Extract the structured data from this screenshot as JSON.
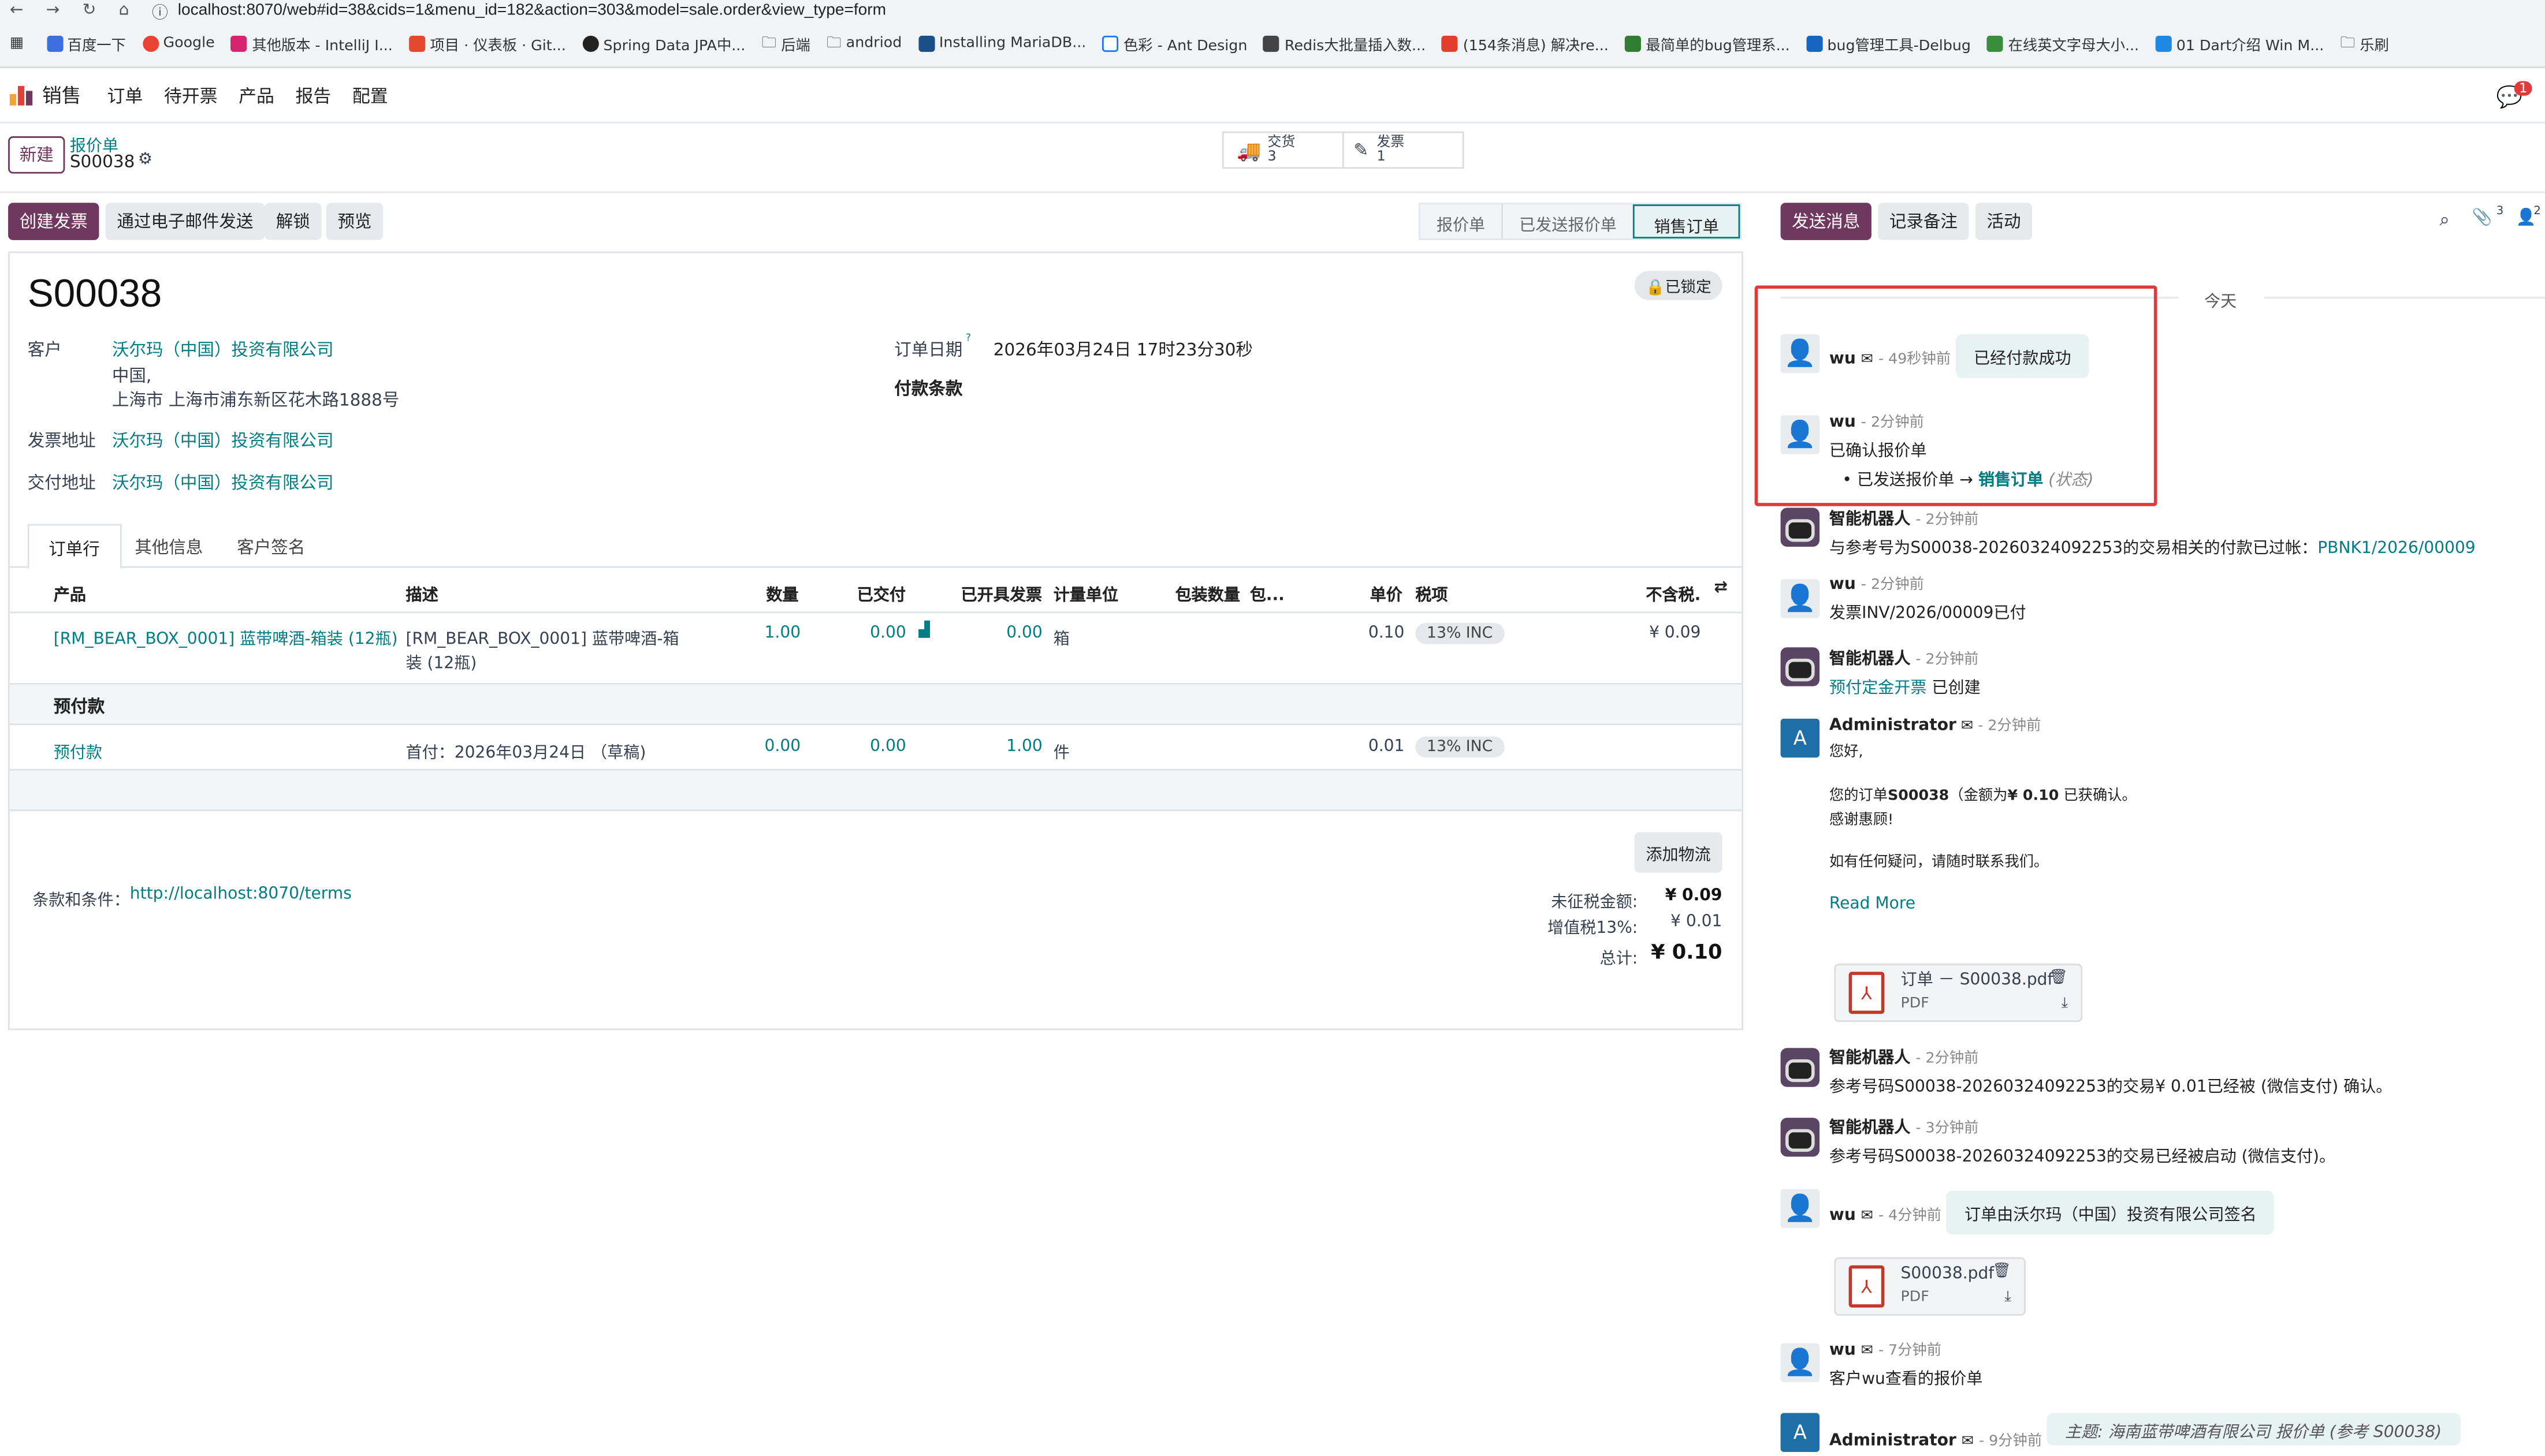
{
  "browser": {
    "url": "localhost:8070/web#id=38&cids=1&menu_id=182&action=303&model=sale.order&view_type=form",
    "bookmarks": [
      "百度一下",
      "Google",
      "其他版本 - IntelliJ I...",
      "项目 · 仪表板 · Git...",
      "Spring Data JPA中...",
      "后端",
      "andriod",
      "Installing MariaDB...",
      "色彩 - Ant Design",
      "Redis大批量插入数...",
      "(154条消息) 解决re...",
      "最简单的bug管理系...",
      "bug管理工具-Delbug",
      "在线英文字母大小...",
      "01 Dart介绍 Win M...",
      "乐刷"
    ]
  },
  "nav": {
    "app": "销售",
    "items": [
      "订单",
      "待开票",
      "产品",
      "报告",
      "配置"
    ],
    "chat_badge": "1"
  },
  "cp": {
    "new": "新建",
    "breadcrumb": "报价单",
    "record": "S00038",
    "delivery_label": "交货",
    "delivery_count": "3",
    "invoice_label": "发票",
    "invoice_count": "1"
  },
  "actions": {
    "create_invoice": "创建发票",
    "send_email": "通过电子邮件发送",
    "unlock": "解锁",
    "preview": "预览"
  },
  "status": [
    "报价单",
    "已发送报价单",
    "销售订单"
  ],
  "form": {
    "title": "S00038",
    "locked": "已锁定",
    "customer_label": "客户",
    "customer": "沃尔玛（中国）投资有限公司",
    "addr1": "中国,",
    "addr2": "上海市 上海市浦东新区花木路1888号",
    "invoice_addr_label": "发票地址",
    "invoice_addr": "沃尔玛（中国）投资有限公司",
    "delivery_addr_label": "交付地址",
    "delivery_addr": "沃尔玛（中国）投资有限公司",
    "order_date_label": "订单日期",
    "order_date_sup": "?",
    "order_date": "2026年03月24日 17时23分30秒",
    "payment_terms_label": "付款条款",
    "tabs": [
      "订单行",
      "其他信息",
      "客户签名"
    ],
    "columns": [
      "产品",
      "描述",
      "数量",
      "已交付",
      "已开具发票",
      "计量单位",
      "包装数量",
      "包...",
      "单价",
      "税项",
      "不含税."
    ],
    "line1": {
      "product": "[RM_BEAR_BOX_0001] 蓝带啤酒-箱装 (12瓶)",
      "desc1": "[RM_BEAR_BOX_0001] 蓝带啤酒-箱",
      "desc2": "装 (12瓶)",
      "qty": "1.00",
      "delivered": "0.00",
      "invoiced": "0.00",
      "uom": "箱",
      "price": "0.10",
      "tax": "13% INC",
      "subtotal": "¥ 0.09"
    },
    "section": "预付款",
    "line2": {
      "product": "预付款",
      "desc": "首付：2026年03月24日 （草稿)",
      "qty": "0.00",
      "delivered": "0.00",
      "invoiced": "1.00",
      "uom": "件",
      "price": "0.01",
      "tax": "13% INC"
    },
    "add_shipping": "添加物流",
    "terms_label": "条款和条件：",
    "terms_link": "http://localhost:8070/terms",
    "untaxed_label": "未征税金额:",
    "untaxed": "¥ 0.09",
    "vat_label": "增值税13%:",
    "vat": "¥ 0.01",
    "total_label": "总计:",
    "total": "¥ 0.10"
  },
  "chatter": {
    "send": "发送消息",
    "note": "记录备注",
    "activity": "活动",
    "attach_count": "3",
    "follow_count": "2",
    "today": "今天",
    "m1": {
      "name": "wu",
      "time": "- 49秒钟前",
      "body": "已经付款成功"
    },
    "m2": {
      "name": "wu",
      "time": "- 2分钟前",
      "body": "已确认报价单",
      "old": "已发送报价单",
      "arrow": "→",
      "new": "销售订单",
      "field": "(状态)"
    },
    "m3": {
      "name": "智能机器人",
      "time": "- 2分钟前",
      "body": "与参考号为S00038-20260324092253的交易相关的付款已过帐：",
      "link": "PBNK1/2026/00009"
    },
    "m4": {
      "name": "wu",
      "time": "- 2分钟前",
      "body": "发票INV/2026/00009已付"
    },
    "m5": {
      "name": "智能机器人",
      "time": "- 2分钟前",
      "link": "预付定金开票",
      "body": "已创建"
    },
    "m6": {
      "name": "Administrator",
      "time": "- 2分钟前",
      "l1": "您好,",
      "l2a": "您的订单",
      "l2b": "S00038",
      "l2c": "（金额为",
      "l2d": "¥ 0.10",
      "l2e": "已获确认。",
      "l3": "感谢惠顾!",
      "l4": "如有任何疑问，请随时联系我们。",
      "more": "Read More",
      "file": "订单 － S00038.pdf",
      "ftype": "PDF"
    },
    "m7": {
      "name": "智能机器人",
      "time": "- 2分钟前",
      "body": "参考号码S00038-20260324092253的交易¥ 0.01已经被 (微信支付) 确认。"
    },
    "m8": {
      "name": "智能机器人",
      "time": "- 3分钟前",
      "body": "参考号码S00038-20260324092253的交易已经被启动 (微信支付)。"
    },
    "m9": {
      "name": "wu",
      "time": "- 4分钟前",
      "body": "订单由沃尔玛（中国）投资有限公司签名",
      "file": "S00038.pdf",
      "ftype": "PDF"
    },
    "m10": {
      "name": "wu",
      "time": "- 7分钟前",
      "body": "客户wu查看的报价单"
    },
    "m11": {
      "name": "Administrator",
      "time": "- 9分钟前",
      "body": "主题: 海南蓝带啤酒有限公司 报价单 (参考 S00038)"
    }
  },
  "colors": {
    "brand": "#71385f",
    "link": "#017e84",
    "highlight": "#e03a3a"
  }
}
